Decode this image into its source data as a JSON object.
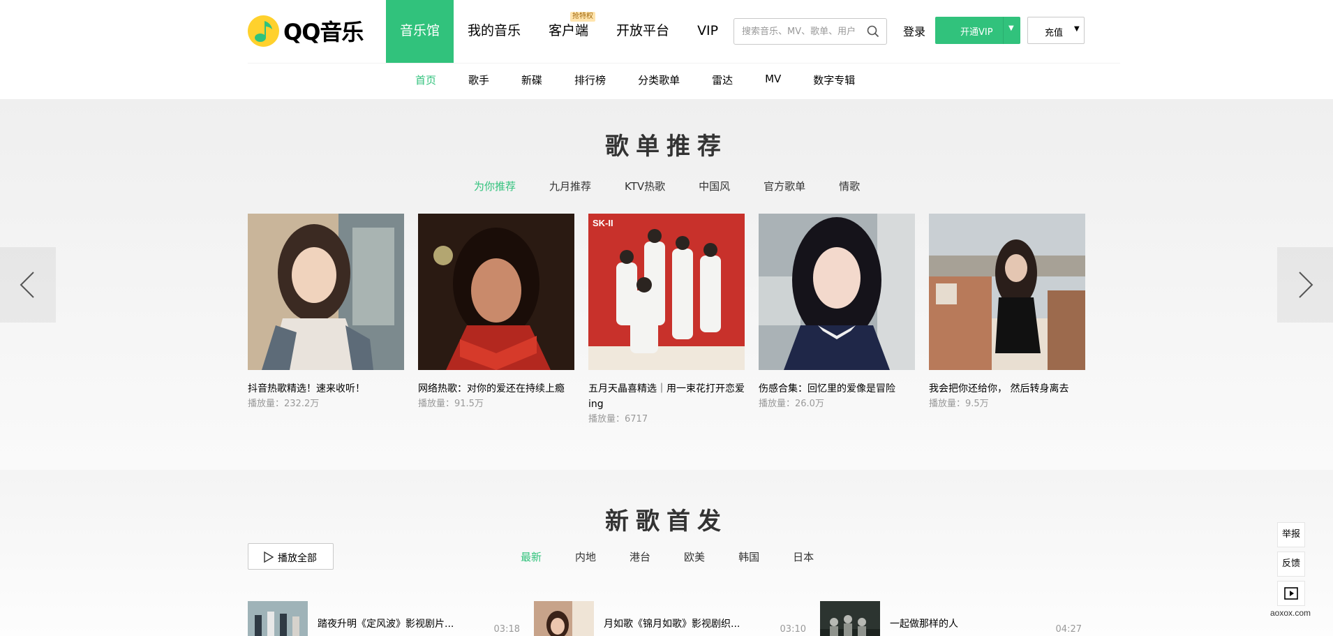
{
  "header": {
    "logo_text": "QQ音乐",
    "nav_main": [
      {
        "label": "音乐馆",
        "active": true
      },
      {
        "label": "我的音乐"
      },
      {
        "label": "客户端",
        "badge": "抢特权"
      },
      {
        "label": "开放平台"
      },
      {
        "label": "VIP"
      }
    ],
    "search_placeholder": "搜索音乐、MV、歌单、用户",
    "login_label": "登录",
    "vip_button_label": "开通VIP",
    "recharge_label": "充值",
    "nav_sub": [
      {
        "label": "首页",
        "active": true
      },
      {
        "label": "歌手"
      },
      {
        "label": "新碟"
      },
      {
        "label": "排行榜"
      },
      {
        "label": "分类歌单"
      },
      {
        "label": "雷达"
      },
      {
        "label": "MV"
      },
      {
        "label": "数字专辑"
      }
    ],
    "accent_color": "#31c27c"
  },
  "playlist_section": {
    "title": "歌单推荐",
    "tabs": [
      {
        "label": "为你推荐",
        "active": true
      },
      {
        "label": "九月推荐"
      },
      {
        "label": "KTV热歌"
      },
      {
        "label": "中国风"
      },
      {
        "label": "官方歌单"
      },
      {
        "label": "情歌"
      }
    ],
    "cards": [
      {
        "title": "抖音热歌精选！速来收听！",
        "plays": "播放量：232.2万"
      },
      {
        "title": "网络热歌：对你的爱还在持续上瘾",
        "plays": "播放量：91.5万"
      },
      {
        "title": "五月天晶喜精选｜用一束花打开恋爱ing",
        "plays": "播放量：6717"
      },
      {
        "title": "伤感合集：回忆里的爱像是冒险",
        "plays": "播放量：26.0万"
      },
      {
        "title": "我会把你还给你， 然后转身离去",
        "plays": "播放量：9.5万"
      }
    ],
    "pager_total": 5,
    "pager_current": 1,
    "cover3_logo": "SK-II"
  },
  "new_song_section": {
    "title": "新歌首发",
    "play_all_label": "播放全部",
    "tabs": [
      {
        "label": "最新",
        "active": true
      },
      {
        "label": "内地"
      },
      {
        "label": "港台"
      },
      {
        "label": "欧美"
      },
      {
        "label": "韩国"
      },
      {
        "label": "日本"
      }
    ],
    "songs": [
      {
        "name": "踏夜升明《定风波》影视剧片...",
        "duration": "03:18"
      },
      {
        "name": "月如歌《锦月如歌》影视剧织...",
        "duration": "03:10"
      },
      {
        "name": "一起做那样的人",
        "duration": "04:27"
      }
    ]
  },
  "side_tools": {
    "report_label": "举报",
    "feedback_label": "反馈"
  },
  "watermark": "aoxox.com"
}
